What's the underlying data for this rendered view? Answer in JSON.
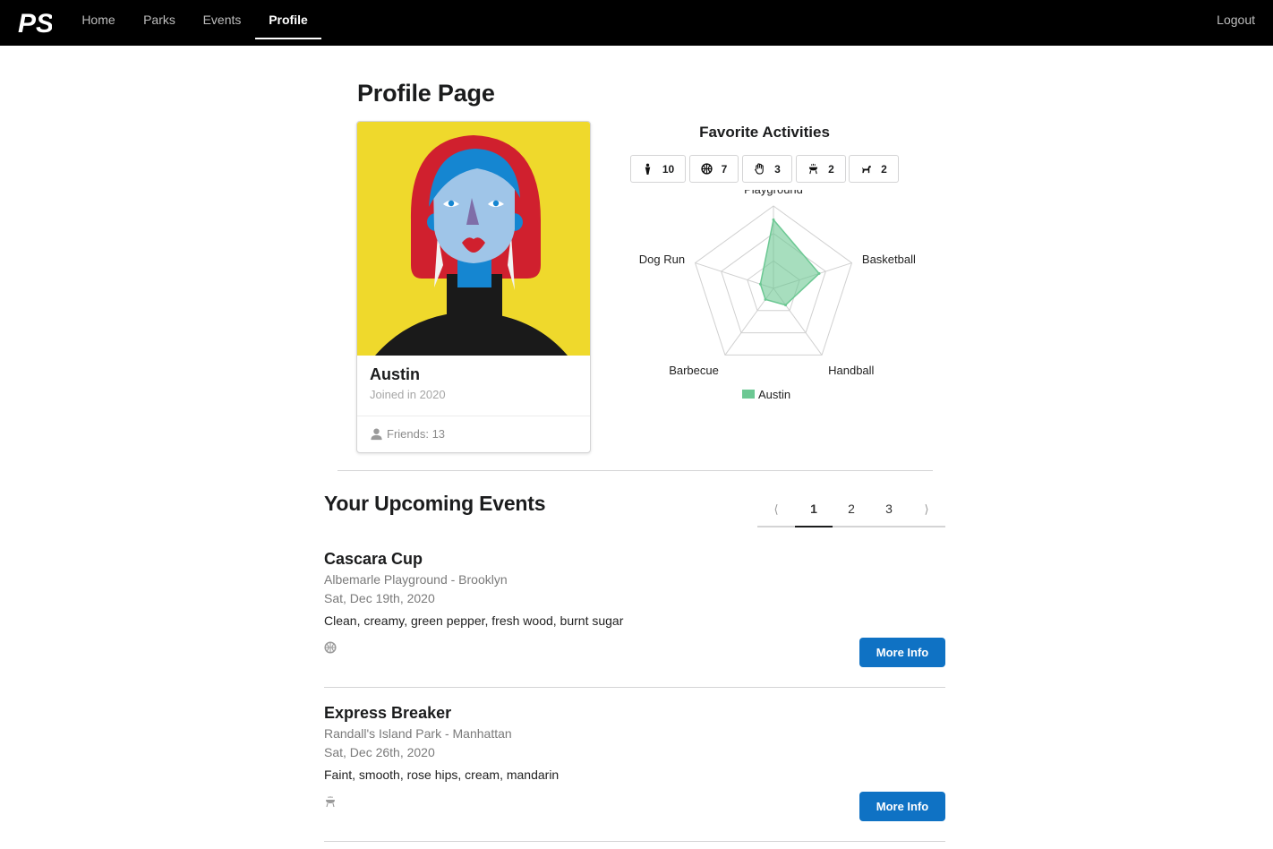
{
  "nav": {
    "logo_text": "PS",
    "items": [
      {
        "label": "Home"
      },
      {
        "label": "Parks"
      },
      {
        "label": "Events"
      },
      {
        "label": "Profile"
      }
    ],
    "active": "Profile",
    "logout_label": "Logout"
  },
  "page_title": "Profile Page",
  "profile": {
    "name": "Austin",
    "joined": "Joined in 2020",
    "friends": "Friends: 13",
    "avatar_icon": "woman-portrait-illustration"
  },
  "favorites": {
    "title": "Favorite Activities",
    "chips": [
      {
        "icon": "playground-icon",
        "count": "10"
      },
      {
        "icon": "basketball-icon",
        "count": "7"
      },
      {
        "icon": "handball-icon",
        "count": "3"
      },
      {
        "icon": "barbecue-icon",
        "count": "2"
      },
      {
        "icon": "dog-icon",
        "count": "2"
      }
    ]
  },
  "chart_data": {
    "type": "radar",
    "axes": [
      "Playground",
      "Basketball",
      "Handball",
      "Barbecue",
      "Dog Run"
    ],
    "series": [
      {
        "name": "Austin",
        "values": [
          10,
          7,
          3,
          2,
          2
        ],
        "color": "#6cc893"
      }
    ],
    "rmax": 12,
    "grid_levels": 3,
    "legend": "bottom"
  },
  "events": {
    "title": "Your Upcoming Events",
    "pagination": {
      "prev": "⟨",
      "pages": [
        "1",
        "2",
        "3"
      ],
      "next": "⟩",
      "current": "1"
    },
    "items": [
      {
        "title": "Cascara Cup",
        "place": "Albemarle Playground - Brooklyn",
        "date": "Sat, Dec 19th, 2020",
        "description": "Clean, creamy, green pepper, fresh wood, burnt sugar",
        "icon": "basketball-icon",
        "button": "More Info"
      },
      {
        "title": "Express Breaker",
        "place": "Randall's Island Park - Manhattan",
        "date": "Sat, Dec 26th, 2020",
        "description": "Faint, smooth, rose hips, cream, mandarin",
        "icon": "barbecue-icon",
        "button": "More Info"
      }
    ]
  },
  "colors": {
    "nav_bg": "#000000",
    "primary_button": "#0f72c4",
    "radar_fill": "#6cc893",
    "avatar_bg": "#efd92c",
    "avatar_hair": "#d0202e",
    "avatar_face": "#9fc5e8"
  }
}
